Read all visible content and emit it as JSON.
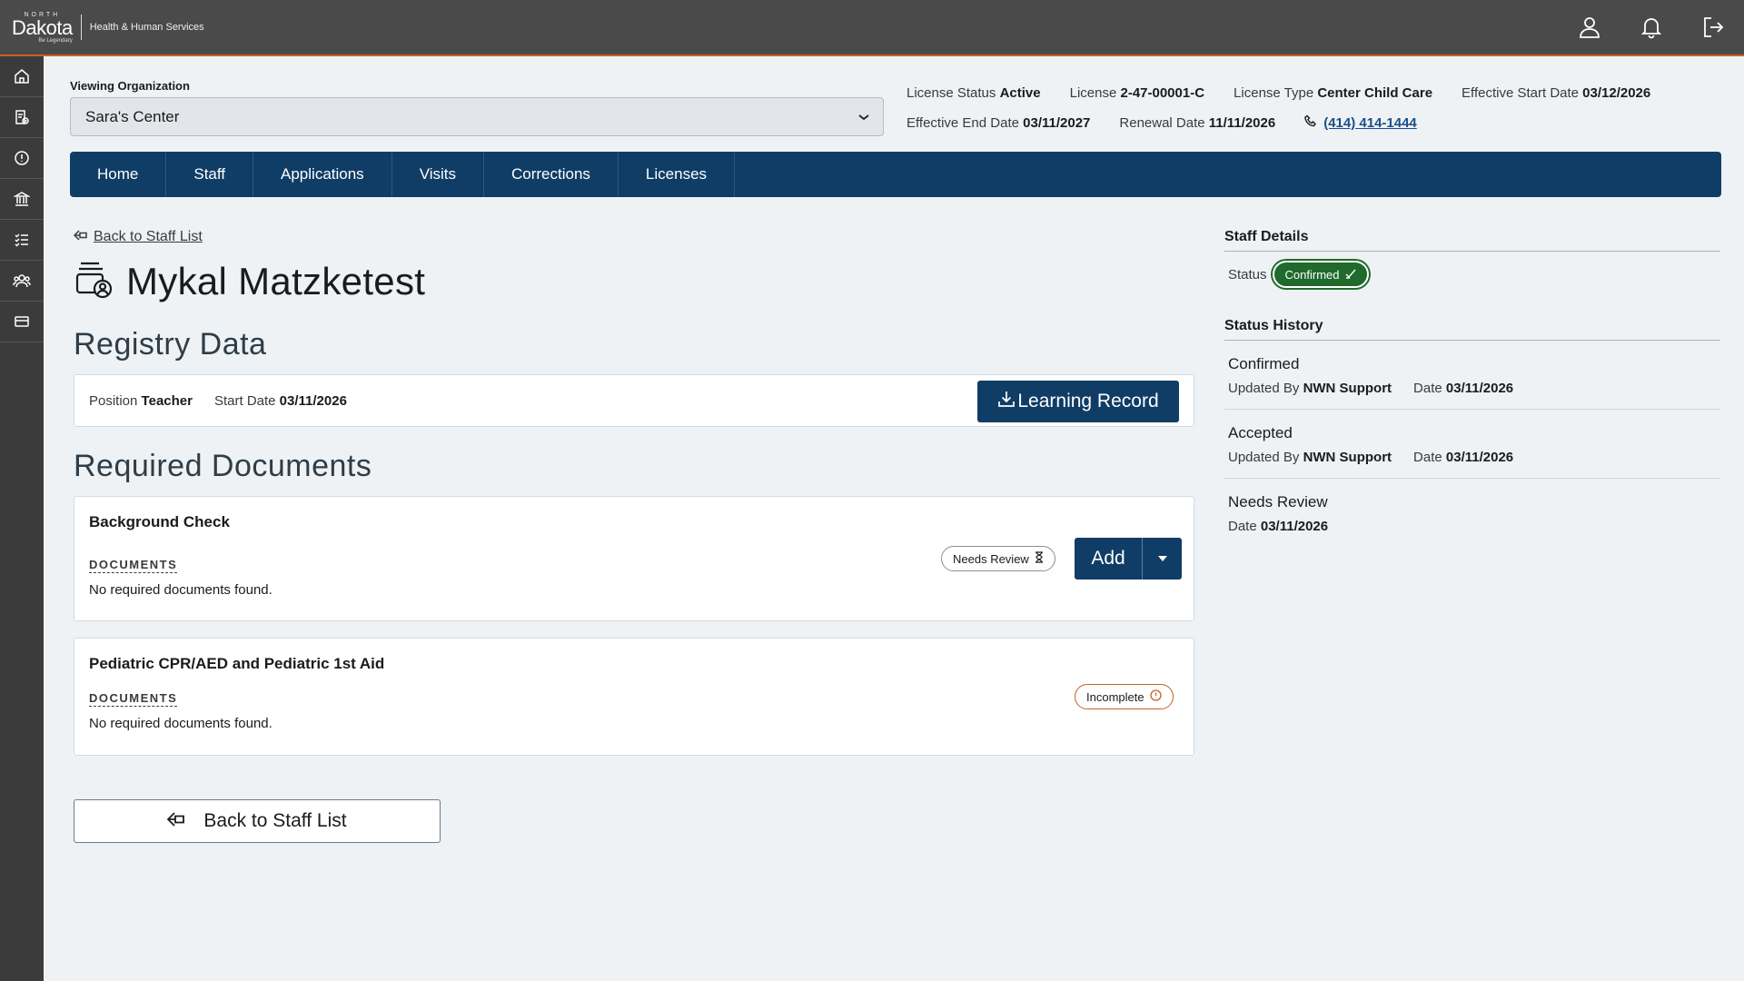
{
  "header": {
    "brand_north": "NORTH",
    "brand_name": "Dakota",
    "brand_tagline": "Be Legendary",
    "brand_department": "Health & Human Services",
    "icons": [
      "user-icon",
      "bell-icon",
      "logout-icon"
    ]
  },
  "sidebar": {
    "icons": [
      "home-icon",
      "document-check-icon",
      "alert-clock-icon",
      "building-icon",
      "checklist-icon",
      "people-icon",
      "card-icon"
    ]
  },
  "organization": {
    "label": "Viewing Organization",
    "selected": "Sara's Center"
  },
  "license": {
    "status_label": "License Status",
    "status_value": "Active",
    "number_label": "License",
    "number_value": "2-47-00001-C",
    "type_label": "License Type",
    "type_value": "Center Child Care",
    "start_label": "Effective Start Date",
    "start_value": "03/12/2026",
    "end_label": "Effective End Date",
    "end_value": "03/11/2027",
    "renewal_label": "Renewal Date",
    "renewal_value": "11/11/2026",
    "phone": "(414) 414-1444"
  },
  "nav": {
    "items": [
      {
        "label": "Home"
      },
      {
        "label": "Staff"
      },
      {
        "label": "Applications"
      },
      {
        "label": "Visits"
      },
      {
        "label": "Corrections"
      },
      {
        "label": "Licenses"
      }
    ]
  },
  "staff": {
    "back_link": "Back to Staff List",
    "name": "Mykal Matzketest"
  },
  "registry": {
    "heading": "Registry Data",
    "position_label": "Position",
    "position_value": "Teacher",
    "start_label": "Start Date",
    "start_value": "03/11/2026",
    "learning_button": "Learning Record"
  },
  "required_documents": {
    "heading": "Required Documents",
    "items": [
      {
        "title": "Background Check",
        "sub_label": "DOCUMENTS",
        "empty_text": "No required documents found.",
        "status": "Needs Review",
        "add_label": "Add"
      },
      {
        "title": "Pediatric CPR/AED and Pediatric 1st Aid",
        "sub_label": "DOCUMENTS",
        "empty_text": "No required documents found.",
        "status": "Incomplete"
      }
    ]
  },
  "back_button": "Back to Staff List",
  "staff_details": {
    "heading": "Staff Details",
    "status_label": "Status",
    "status_value": "Confirmed"
  },
  "status_history": {
    "heading": "Status History",
    "items": [
      {
        "status": "Confirmed",
        "updated_label": "Updated By",
        "updated_by": "NWN Support",
        "date_label": "Date",
        "date": "03/11/2026"
      },
      {
        "status": "Accepted",
        "updated_label": "Updated By",
        "updated_by": "NWN Support",
        "date_label": "Date",
        "date": "03/11/2026"
      },
      {
        "status": "Needs Review",
        "date_label": "Date",
        "date": "03/11/2026"
      }
    ]
  },
  "colors": {
    "topbar": "#4a4a4a",
    "accent_orange": "#c8622a",
    "nav_blue": "#103d66",
    "confirmed_green": "#1f6a2c",
    "background": "#eef2f5"
  }
}
